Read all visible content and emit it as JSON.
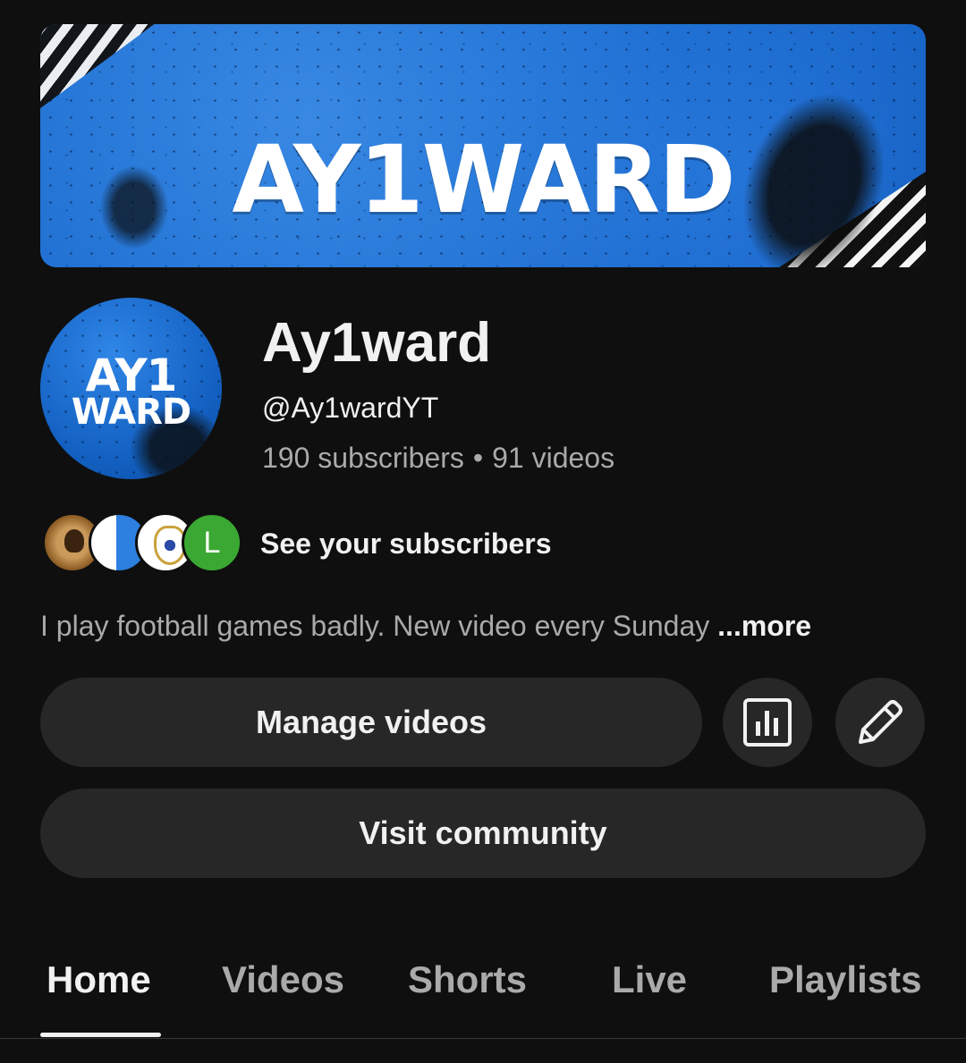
{
  "banner": {
    "logo_text": "AY1WARD"
  },
  "avatar": {
    "line1": "AY1",
    "line2": "WARD"
  },
  "channel": {
    "name": "Ay1ward",
    "handle": "@Ay1wardYT",
    "subscribers": "190 subscribers",
    "separator": "•",
    "videos": "91 videos"
  },
  "subscribers_preview": {
    "avatar_letter": "L",
    "label": "See your subscribers"
  },
  "description": {
    "text": "I play football games badly. New video every Sunday",
    "more_label": "...more"
  },
  "actions": {
    "manage_videos": "Manage videos",
    "visit_community": "Visit community",
    "stats_icon": "bar-chart-icon",
    "edit_icon": "pencil-icon"
  },
  "tabs": [
    {
      "label": "Home",
      "active": true
    },
    {
      "label": "Videos",
      "active": false
    },
    {
      "label": "Shorts",
      "active": false
    },
    {
      "label": "Live",
      "active": false
    },
    {
      "label": "Playlists",
      "active": false
    }
  ],
  "colors": {
    "background": "#0f0f0f",
    "button_bg": "#272727",
    "text_primary": "#f1f1f1",
    "text_secondary": "#aaaaaa",
    "banner_blue": "#1567cc"
  }
}
